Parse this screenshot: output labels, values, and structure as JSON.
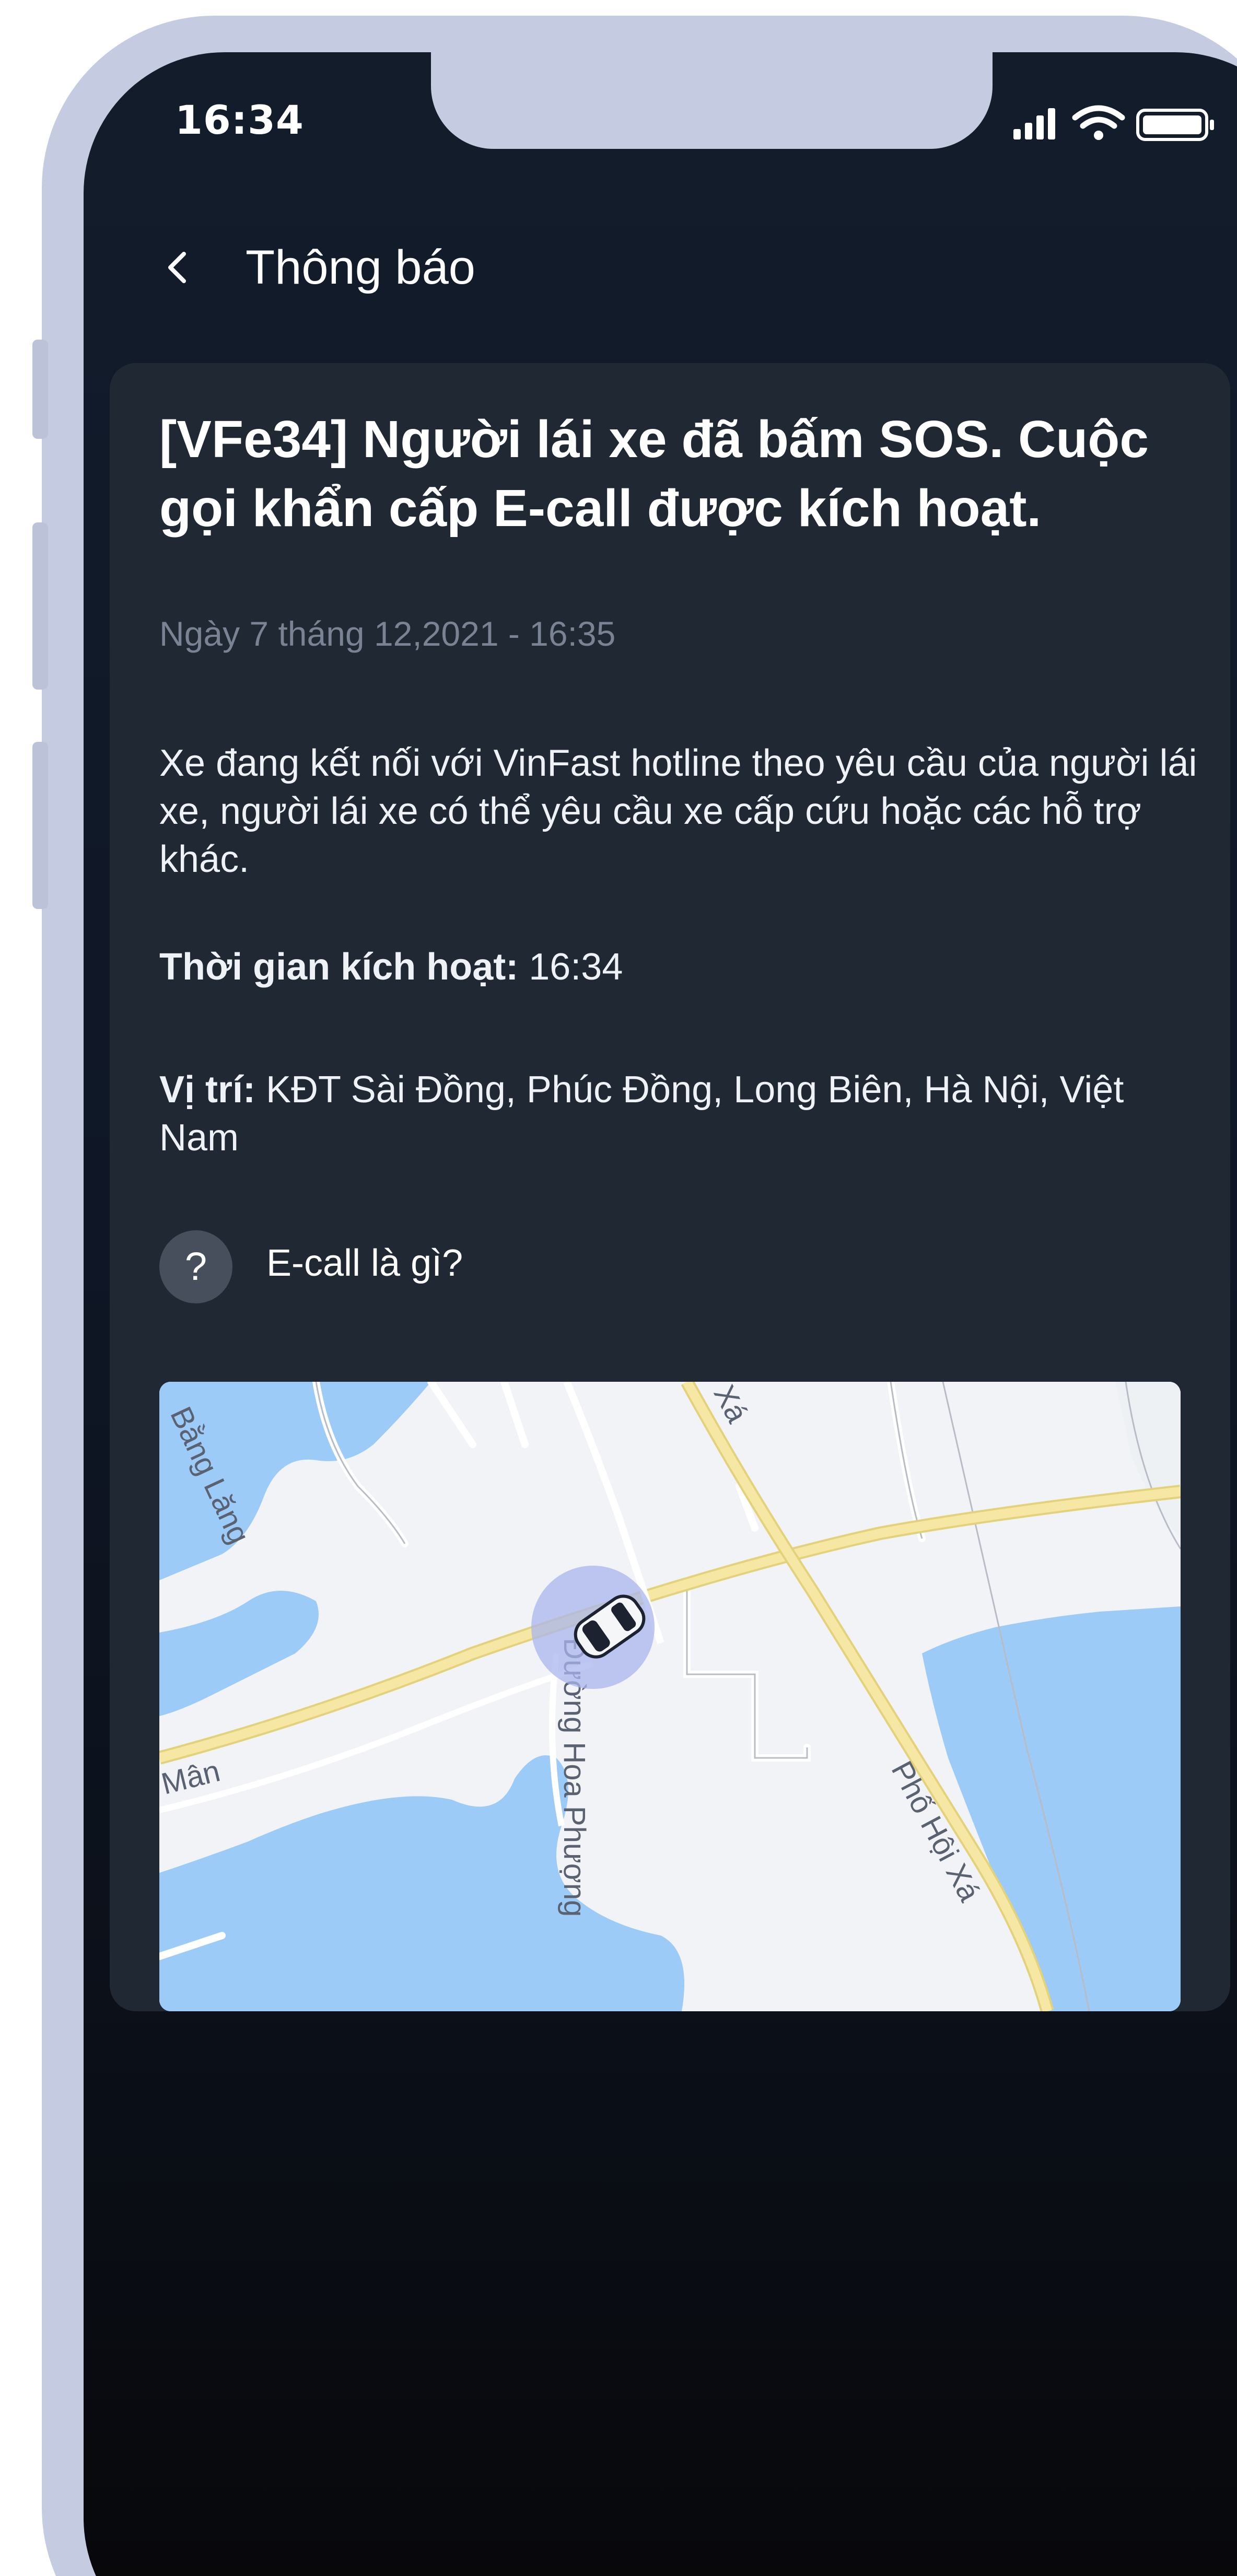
{
  "status_bar": {
    "time": "16:34"
  },
  "header": {
    "back_icon": "chevron-left-icon",
    "title": "Thông báo"
  },
  "notification": {
    "title": "[VFe34] Người lái xe đã bấm SOS. Cuộc gọi khẩn cấp E-call được kích hoạt.",
    "date": "Ngày 7 tháng 12,2021 - 16:35",
    "body": "Xe đang kết nối với VinFast hotline theo yêu cầu của người lái xe, người lái xe có thể yêu cầu xe cấp cứu hoặc các hỗ trợ khác.",
    "activation_time_label": "Thời gian kích hoạt:",
    "activation_time_value": "16:34",
    "location_label": "Vị trí:",
    "location_value": "KĐT Sài Đồng, Phúc Đồng, Long Biên, Hà Nội, Việt Nam",
    "help_icon_text": "?",
    "help_link": "E-call là gì?"
  },
  "map": {
    "labels": {
      "road_top_left": "Bằng Lăng",
      "road_left": "Mân",
      "road_top": "Xá",
      "road_center": "Đường Hoa Phượng",
      "road_right": "Phố Hội Xá"
    },
    "marker_icon": "car-icon"
  },
  "colors": {
    "accent_water": "#9ccbf7",
    "road_yellow": "#f6e7a4",
    "marker_halo": "#aab5ee"
  }
}
